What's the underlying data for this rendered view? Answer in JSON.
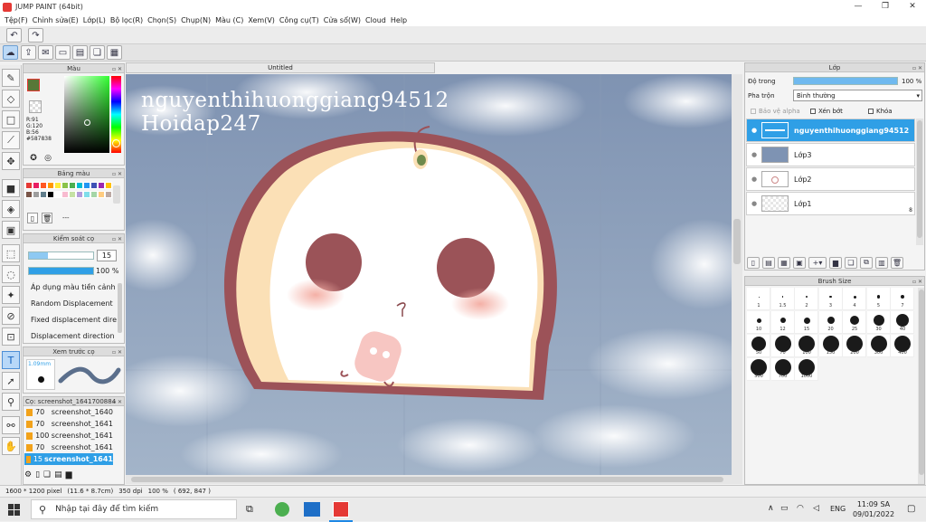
{
  "window": {
    "title": "JUMP PAINT (64bit)",
    "min": "—",
    "max": "❐",
    "close": "✕"
  },
  "menu": [
    "Tệp(F)",
    "Chỉnh sửa(E)",
    "Lớp(L)",
    "Bộ lọc(R)",
    "Chọn(S)",
    "Chụp(N)",
    "Màu (C)",
    "Xem(V)",
    "Công cụ(T)",
    "Cửa sổ(W)",
    "Cloud",
    "Help"
  ],
  "doc_tab": "Untitled",
  "color_panel": {
    "title": "Màu",
    "current_color": "#587838",
    "rgb": {
      "r": "R:91",
      "g": "G:120",
      "b": "B:56",
      "hex": "#587838"
    }
  },
  "palette_panel": {
    "title": "Bảng màu",
    "swatches": [
      "#e53935",
      "#e91e63",
      "#ff5722",
      "#ff9800",
      "#ffeb3b",
      "#8bc34a",
      "#4caf50",
      "#00bcd4",
      "#2196f3",
      "#3f51b5",
      "#9c27b0",
      "#ffc107",
      "#795548",
      "#9e9e9e",
      "#607d8b",
      "#000000",
      "#ffffff",
      "#f8bbd0",
      "#c5e1a5",
      "#b39ddb",
      "#80deea",
      "#a5d6a7",
      "#ffcc80",
      "#bcaaa4"
    ],
    "more": "---"
  },
  "brush_control": {
    "title": "Kiểm soát cọ",
    "size_value": "15",
    "opacity_value": "100 %",
    "opacity_fraction": 1.0,
    "options": [
      "Áp dụng màu tiền cảnh",
      "Random Displacement",
      "Fixed displacement dire",
      "Displacement direction"
    ]
  },
  "brush_preview": {
    "title": "Xem trước cọ",
    "size_label": "1.09mm"
  },
  "materials": {
    "title": "Cọ: screenshot_1641700884",
    "rows": [
      {
        "value": "70",
        "name": "screenshot_1640"
      },
      {
        "value": "70",
        "name": "screenshot_1641"
      },
      {
        "value": "100",
        "name": "screenshot_1641"
      },
      {
        "value": "70",
        "name": "screenshot_1641"
      },
      {
        "value": "15",
        "name": "screenshot_1641"
      }
    ]
  },
  "layers_panel": {
    "title": "Lớp",
    "opacity_label": "Độ trong",
    "opacity_value": "100 %",
    "opacity_fraction": 1.0,
    "blend_label": "Pha trộn",
    "blend_value": "Bình thường",
    "protect_alpha": "Bảo vệ alpha",
    "clipping": "Xén bớt",
    "lock": "Khóa",
    "layers": [
      {
        "name": "nguyenthihuonggiang94512"
      },
      {
        "name": "Lớp3"
      },
      {
        "name": "Lớp2"
      },
      {
        "name": "Lớp1",
        "badge": "8"
      }
    ]
  },
  "brush_size_panel": {
    "title": "Brush Size",
    "sizes": [
      "1",
      "1.5",
      "2",
      "3",
      "4",
      "5",
      "7",
      "10",
      "12",
      "15",
      "20",
      "25",
      "30",
      "40",
      "50",
      "70",
      "100",
      "150",
      "200",
      "300",
      "400",
      "500",
      "700",
      "1000"
    ]
  },
  "canvas": {
    "watermark_line1": "nguyenthihuonggiang94512",
    "watermark_line2": "Hoidap247"
  },
  "status": {
    "dimensions": "1600 * 1200 pixel",
    "physical": "(11.6 * 8.7cm)",
    "dpi": "350 dpi",
    "zoom": "100 %",
    "coords": "( 692, 847 )"
  },
  "taskbar": {
    "search_placeholder": "Nhập tại đây để tìm kiếm",
    "lang": "ENG",
    "time": "11:09 SA",
    "date": "09/01/2022"
  }
}
